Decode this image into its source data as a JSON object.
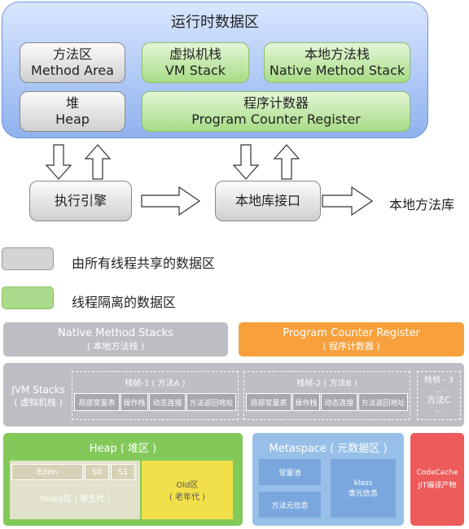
{
  "top": {
    "runtime_area": "运行时数据区",
    "method_area": {
      "cn": "方法区",
      "en": "Method Area"
    },
    "vm_stack": {
      "cn": "虚拟机栈",
      "en": "VM Stack"
    },
    "native_stack": {
      "cn": "本地方法栈",
      "en": "Native Method Stack"
    },
    "heap": {
      "cn": "堆",
      "en": "Heap"
    },
    "pc_register": {
      "cn": "程序计数器",
      "en": "Program Counter Register"
    },
    "exec_engine": "执行引擎",
    "native_interface": "本地库接口",
    "native_library": "本地方法库"
  },
  "legend": [
    {
      "label": "由所有线程共享的数据区",
      "color": "#d4d4d4"
    },
    {
      "label": "线程隔离的数据区",
      "color": "#a9db8a"
    }
  ],
  "bottom": {
    "native_stacks": {
      "en": "Native Method Stacks",
      "cn": "( 本地方法栈 )"
    },
    "pc_register": {
      "en": "Program Counter Register",
      "cn": "( 程序计数器 )"
    },
    "jvm_stacks": {
      "en": "JVM Stacks",
      "cn": "( 虚拟机栈 )"
    },
    "frames": [
      {
        "title": "栈帧-1 ( 方法A )",
        "cells": [
          "局部变量表",
          "操作栈",
          "动态连接",
          "方法返回地址"
        ]
      },
      {
        "title": "栈帧-2 ( 方法B )",
        "cells": [
          "局部变量表",
          "操作栈",
          "动态连接",
          "方法返回地址"
        ]
      }
    ],
    "frame3": {
      "title": "栈帧 - 3",
      "dots": "...",
      "method": "方法C"
    },
    "heap": {
      "title": "Heap ( 堆区 )",
      "eden": "Eden",
      "s0": "S0",
      "s1": "S1",
      "young": "Young区 ( 新生代 )",
      "old": "Old区",
      "old_cn": "( 老年代 )"
    },
    "metaspace": {
      "title": "Metaspace ( 元数据区 )",
      "constant_pool": "常量池",
      "method_meta": "方法元信息",
      "klass": "klass",
      "klass_cn": "类元信息"
    },
    "codecache": {
      "title": "CodeCache",
      "sub": "JIT编译产物"
    }
  },
  "colors": {
    "runtime_bg": "#8fb2ee",
    "green": "#a7dc86",
    "orange": "#f7a03c",
    "heap_green": "#82c95a",
    "metaspace_blue": "#97bfe8",
    "codecache_red": "#ee5b5b",
    "old_yellow": "#f2e04a"
  }
}
